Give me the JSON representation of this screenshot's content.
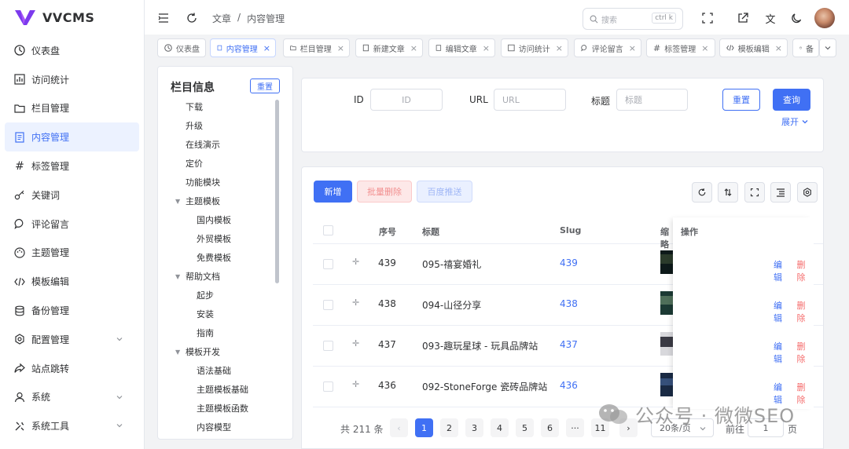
{
  "app": {
    "name": "VVCMS"
  },
  "sidebar": {
    "items": [
      {
        "label": "仪表盘",
        "icon": "dashboard-icon"
      },
      {
        "label": "访问统计",
        "icon": "bar-chart-icon"
      },
      {
        "label": "栏目管理",
        "icon": "folder-icon"
      },
      {
        "label": "内容管理",
        "icon": "document-icon",
        "active": true
      },
      {
        "label": "标签管理",
        "icon": "hash-icon"
      },
      {
        "label": "关键词",
        "icon": "key-icon"
      },
      {
        "label": "评论留言",
        "icon": "comment-icon"
      },
      {
        "label": "主题管理",
        "icon": "palette-icon"
      },
      {
        "label": "模板编辑",
        "icon": "code-icon"
      },
      {
        "label": "备份管理",
        "icon": "database-icon"
      },
      {
        "label": "配置管理",
        "icon": "settings-icon",
        "expandable": true
      },
      {
        "label": "站点跳转",
        "icon": "share-icon"
      },
      {
        "label": "系统",
        "icon": "user-icon",
        "expandable": true
      },
      {
        "label": "系统工具",
        "icon": "tools-icon",
        "expandable": true
      }
    ]
  },
  "topbar": {
    "breadcrumb": [
      "文章",
      "/",
      "内容管理"
    ],
    "search_placeholder": "搜索",
    "search_shortcut": "ctrl k"
  },
  "tabs": [
    {
      "label": "仪表盘",
      "icon": "dashboard-icon"
    },
    {
      "label": "内容管理",
      "icon": "document-icon",
      "active": true,
      "closable": true
    },
    {
      "label": "栏目管理",
      "icon": "folder-icon",
      "closable": true
    },
    {
      "label": "新建文章",
      "icon": "document-icon",
      "closable": true
    },
    {
      "label": "编辑文章",
      "icon": "document-icon",
      "closable": true
    },
    {
      "label": "访问统计",
      "icon": "bar-chart-icon",
      "closable": true
    },
    {
      "label": "评论留言",
      "icon": "comment-icon",
      "closable": true
    },
    {
      "label": "标签管理",
      "icon": "hash-icon",
      "closable": true
    },
    {
      "label": "模板编辑",
      "icon": "code-icon",
      "closable": true
    },
    {
      "label": "备",
      "icon": "database-icon"
    }
  ],
  "tree": {
    "title": "栏目信息",
    "reset_label": "重置",
    "nodes": [
      {
        "label": "下载",
        "level": 0
      },
      {
        "label": "升级",
        "level": 0
      },
      {
        "label": "在线演示",
        "level": 0
      },
      {
        "label": "定价",
        "level": 0
      },
      {
        "label": "功能模块",
        "level": 0
      },
      {
        "label": "主题模板",
        "level": 0,
        "expanded": true
      },
      {
        "label": "国内模板",
        "level": 1
      },
      {
        "label": "外贸模板",
        "level": 1
      },
      {
        "label": "免费模板",
        "level": 1
      },
      {
        "label": "帮助文档",
        "level": 0,
        "expanded": true
      },
      {
        "label": "起步",
        "level": 1
      },
      {
        "label": "安装",
        "level": 1
      },
      {
        "label": "指南",
        "level": 1
      },
      {
        "label": "模板开发",
        "level": 0,
        "expanded": true
      },
      {
        "label": "语法基础",
        "level": 1
      },
      {
        "label": "主题模板基础",
        "level": 1
      },
      {
        "label": "主题模板函数",
        "level": 1
      },
      {
        "label": "内容模型",
        "level": 1
      }
    ]
  },
  "filter": {
    "id_label": "ID",
    "id_placeholder": "ID",
    "url_label": "URL",
    "url_placeholder": "URL",
    "title_label": "标题",
    "title_placeholder": "标题",
    "reset_label": "重置",
    "query_label": "查询",
    "expand_label": "展开"
  },
  "toolbar": {
    "add_label": "新增",
    "batch_delete_label": "批量删除",
    "baidu_push_label": "百度推送"
  },
  "table": {
    "columns": {
      "seq": "序号",
      "title": "标题",
      "slug": "Slug",
      "thumb": "缩略",
      "ops": "操作"
    },
    "rows": [
      {
        "seq": "439",
        "title": "095-禧宴婚礼",
        "slug": "439"
      },
      {
        "seq": "438",
        "title": "094-山径分享",
        "slug": "438"
      },
      {
        "seq": "437",
        "title": "093-趣玩星球 - 玩具品牌站",
        "slug": "437"
      },
      {
        "seq": "436",
        "title": "092-StoneForge 瓷砖品牌站",
        "slug": "436"
      }
    ],
    "edit_label": "编辑",
    "delete_label": "删除"
  },
  "pager": {
    "total": "共 211 条",
    "pages": [
      "1",
      "2",
      "3",
      "4",
      "5",
      "6",
      "···",
      "11"
    ],
    "current": "1",
    "page_size": "20条/页",
    "goto_label": "前往",
    "goto_value": "1",
    "page_suffix": "页"
  },
  "watermark": {
    "text": "公众号 · 微微SEO"
  },
  "colors": {
    "primary": "#4070f4",
    "danger": "#f56c6c"
  }
}
